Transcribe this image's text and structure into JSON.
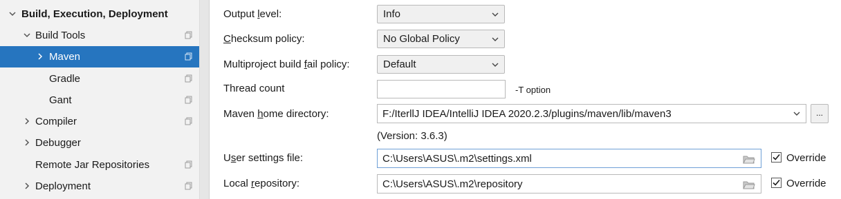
{
  "sidebar": {
    "items": [
      {
        "label": "Build, Execution, Deployment",
        "expanded": true
      },
      {
        "label": "Build Tools",
        "expanded": true
      },
      {
        "label": "Maven",
        "selected": true
      },
      {
        "label": "Gradle"
      },
      {
        "label": "Gant"
      },
      {
        "label": "Compiler"
      },
      {
        "label": "Debugger"
      },
      {
        "label": "Remote Jar Repositories"
      },
      {
        "label": "Deployment"
      }
    ]
  },
  "form": {
    "output_level": {
      "label": "Output level:",
      "mnemonic": "l",
      "value": "Info"
    },
    "checksum_policy": {
      "label": "Checksum policy:",
      "mnemonic": "C",
      "value": "No Global Policy"
    },
    "fail_policy": {
      "label": "Multiproject build fail policy:",
      "mnemonic": "f",
      "value": "Default"
    },
    "thread_count": {
      "label": "Thread count",
      "value": "",
      "note": "-T option"
    },
    "maven_home": {
      "label": "Maven home directory:",
      "mnemonic": "h",
      "value": "F:/IterllJ IDEA/IntelliJ IDEA 2020.2.3/plugins/maven/lib/maven3",
      "version": "(Version: 3.6.3)",
      "browse_label": "..."
    },
    "user_settings": {
      "label": "User settings file:",
      "mnemonic": "s",
      "value": "C:\\Users\\ASUS\\.m2\\settings.xml",
      "override_label": "Override",
      "override_checked": true
    },
    "local_repo": {
      "label": "Local repository:",
      "mnemonic": "r",
      "value": "C:\\Users\\ASUS\\.m2\\repository",
      "override_label": "Override",
      "override_checked": true
    }
  },
  "colors": {
    "selection": "#2675bf",
    "sidebar_bg": "#f2f2f2",
    "focus_border": "#6e9fd6"
  }
}
